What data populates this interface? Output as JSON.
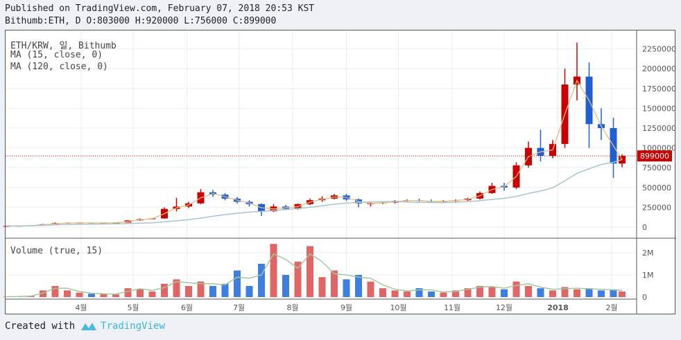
{
  "header": {
    "published": "Published on TradingView.com, February 07, 2018 20:53 KST",
    "ohlc": "Bithumb:ETH, D O:803000 H:920000 L:756000 C:899000"
  },
  "legend": {
    "symbol": "ETH/KRW, 일, Bithumb",
    "ma15": "MA (15, close, 0)",
    "ma120": "MA (120, close, 0)",
    "volume": "Volume (true, 15)"
  },
  "footer": {
    "created_with": "Created with",
    "brand": "TradingView"
  },
  "colors": {
    "up": "#cc0000",
    "down": "#1f5fd6",
    "up_vol": "#e06666",
    "down_vol": "#3d7ee0",
    "ma15": "#e0c080",
    "ma120": "#a8c4cc",
    "vol_ma": "#a3c79a",
    "last_price": "#cc0000"
  },
  "chart_data": {
    "type": "candlestick",
    "last_price_label": "899000",
    "price_axis": {
      "ticks": [
        "0",
        "250000",
        "500000",
        "750000",
        "1000000",
        "1250000",
        "1500000",
        "1750000",
        "2000000",
        "2250000"
      ],
      "ylim": [
        0,
        2450000
      ]
    },
    "volume_axis": {
      "ticks": [
        "0",
        "1M",
        "2M"
      ],
      "ylim": [
        0,
        2700000
      ]
    },
    "x_ticks": [
      {
        "label": "4월",
        "date": "2017-04-01"
      },
      {
        "label": "5월",
        "date": "2017-05-01"
      },
      {
        "label": "6월",
        "date": "2017-06-01"
      },
      {
        "label": "7월",
        "date": "2017-07-01"
      },
      {
        "label": "8월",
        "date": "2017-08-01"
      },
      {
        "label": "9월",
        "date": "2017-09-01"
      },
      {
        "label": "10월",
        "date": "2017-10-01"
      },
      {
        "label": "11월",
        "date": "2017-11-01"
      },
      {
        "label": "12월",
        "date": "2017-12-01"
      },
      {
        "label": "2018",
        "date": "2018-01-01"
      },
      {
        "label": "2월",
        "date": "2018-02-01"
      }
    ],
    "candles": [
      [
        "2017-02-17",
        13000,
        15000,
        12500,
        14000,
        20000
      ],
      [
        "2017-02-24",
        14000,
        17000,
        13500,
        16000,
        30000
      ],
      [
        "2017-03-03",
        16000,
        25000,
        15500,
        22000,
        60000
      ],
      [
        "2017-03-10",
        22000,
        40000,
        21000,
        36000,
        300000
      ],
      [
        "2017-03-17",
        36000,
        60000,
        34000,
        50000,
        500000
      ],
      [
        "2017-03-24",
        50000,
        60000,
        45000,
        54000,
        300000
      ],
      [
        "2017-03-31",
        54000,
        62000,
        50000,
        55000,
        200000
      ],
      [
        "2017-04-07",
        55000,
        60000,
        50000,
        52000,
        150000
      ],
      [
        "2017-04-14",
        52000,
        58000,
        48000,
        54000,
        150000
      ],
      [
        "2017-04-21",
        54000,
        62000,
        52000,
        58000,
        120000
      ],
      [
        "2017-04-28",
        58000,
        90000,
        57000,
        85000,
        400000
      ],
      [
        "2017-05-05",
        85000,
        110000,
        80000,
        100000,
        350000
      ],
      [
        "2017-05-12",
        100000,
        115000,
        95000,
        110000,
        250000
      ],
      [
        "2017-05-19",
        110000,
        250000,
        105000,
        230000,
        600000
      ],
      [
        "2017-05-26",
        230000,
        370000,
        200000,
        260000,
        800000
      ],
      [
        "2017-06-02",
        260000,
        320000,
        240000,
        300000,
        500000
      ],
      [
        "2017-06-09",
        300000,
        480000,
        290000,
        440000,
        700000
      ],
      [
        "2017-06-16",
        440000,
        470000,
        380000,
        410000,
        500000
      ],
      [
        "2017-06-23",
        410000,
        430000,
        340000,
        360000,
        600000
      ],
      [
        "2017-06-30",
        360000,
        380000,
        300000,
        320000,
        1200000
      ],
      [
        "2017-07-07",
        320000,
        340000,
        260000,
        290000,
        500000
      ],
      [
        "2017-07-14",
        290000,
        300000,
        140000,
        200000,
        1500000
      ],
      [
        "2017-07-21",
        200000,
        290000,
        190000,
        260000,
        2400000
      ],
      [
        "2017-07-28",
        260000,
        280000,
        220000,
        230000,
        1000000
      ],
      [
        "2017-08-04",
        230000,
        300000,
        220000,
        290000,
        1600000
      ],
      [
        "2017-08-11",
        290000,
        360000,
        280000,
        340000,
        2300000
      ],
      [
        "2017-08-18",
        340000,
        390000,
        320000,
        360000,
        900000
      ],
      [
        "2017-08-25",
        360000,
        420000,
        350000,
        400000,
        1200000
      ],
      [
        "2017-09-01",
        400000,
        420000,
        330000,
        350000,
        800000
      ],
      [
        "2017-09-08",
        350000,
        360000,
        250000,
        300000,
        1000000
      ],
      [
        "2017-09-15",
        300000,
        320000,
        260000,
        300000,
        700000
      ],
      [
        "2017-09-22",
        300000,
        320000,
        290000,
        310000,
        400000
      ],
      [
        "2017-09-29",
        310000,
        340000,
        300000,
        330000,
        300000
      ],
      [
        "2017-10-06",
        330000,
        350000,
        320000,
        340000,
        250000
      ],
      [
        "2017-10-13",
        340000,
        360000,
        320000,
        330000,
        400000
      ],
      [
        "2017-10-20",
        330000,
        350000,
        310000,
        320000,
        250000
      ],
      [
        "2017-10-27",
        320000,
        340000,
        305000,
        330000,
        200000
      ],
      [
        "2017-11-03",
        330000,
        350000,
        320000,
        340000,
        300000
      ],
      [
        "2017-11-10",
        340000,
        370000,
        330000,
        360000,
        400000
      ],
      [
        "2017-11-17",
        360000,
        450000,
        350000,
        430000,
        500000
      ],
      [
        "2017-11-24",
        430000,
        560000,
        420000,
        520000,
        450000
      ],
      [
        "2017-12-01",
        520000,
        560000,
        460000,
        500000,
        350000
      ],
      [
        "2017-12-08",
        500000,
        820000,
        480000,
        780000,
        700000
      ],
      [
        "2017-12-15",
        780000,
        1080000,
        750000,
        1000000,
        500000
      ],
      [
        "2017-12-22",
        1000000,
        1230000,
        830000,
        900000,
        400000
      ],
      [
        "2017-12-29",
        900000,
        1100000,
        870000,
        1050000,
        300000
      ],
      [
        "2018-01-05",
        1050000,
        2000000,
        1000000,
        1800000,
        450000
      ],
      [
        "2018-01-12",
        1800000,
        2330000,
        1600000,
        1900000,
        350000
      ],
      [
        "2018-01-19",
        1900000,
        2080000,
        1000000,
        1300000,
        400000
      ],
      [
        "2018-01-26",
        1300000,
        1500000,
        1100000,
        1250000,
        300000
      ],
      [
        "2018-02-02",
        1250000,
        1380000,
        620000,
        803000,
        350000
      ],
      [
        "2018-02-07",
        803000,
        920000,
        756000,
        899000,
        250000
      ]
    ]
  }
}
